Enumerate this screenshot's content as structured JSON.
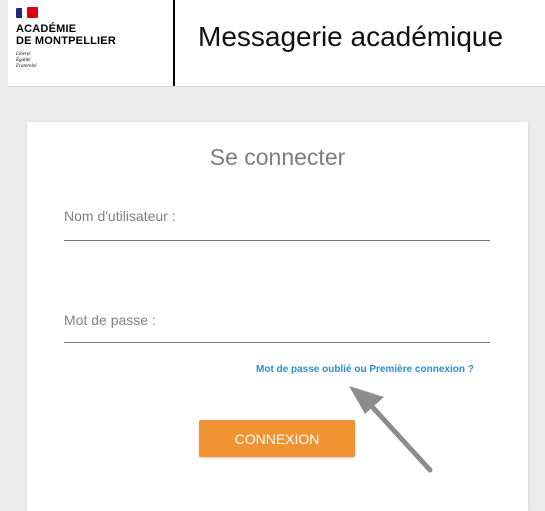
{
  "header": {
    "logo": {
      "line1": "ACADÉMIE",
      "line2": "DE MONTPELLIER",
      "motto": [
        "Liberté",
        "Égalité",
        "Fraternité"
      ],
      "flag_colors": [
        "#1e2a78",
        "#ffffff",
        "#e1000f"
      ]
    },
    "app_title": "Messagerie académique"
  },
  "login": {
    "title": "Se connecter",
    "username_label": "Nom d'utilisateur :",
    "username_value": "",
    "password_label": "Mot de passe :",
    "password_value": "",
    "forgot_link": "Mot de passe oublié ou Première connexion ?",
    "submit_label": "CONNEXION"
  },
  "colors": {
    "background": "#ececec",
    "button": "#f29332",
    "link": "#2c8fd6",
    "arrow": "#8c8c8c"
  },
  "icons": {
    "annotation_arrow": "arrow-icon"
  }
}
